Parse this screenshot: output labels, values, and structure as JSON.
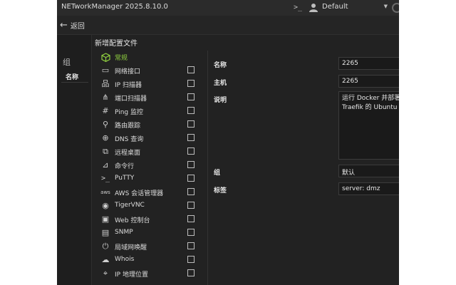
{
  "titlebar": {
    "app_title": "NETworkManager 2025.8.10.0",
    "profile": "Default"
  },
  "toolbar": {
    "back_label": "返回"
  },
  "left_panel": {
    "group_heading": "组",
    "name_header": "名称"
  },
  "dialog": {
    "title": "新增配置文件",
    "nav_items": [
      {
        "label": "常规",
        "icon": "cube-icon",
        "active": true
      },
      {
        "label": "网络接口",
        "icon": "network-interface-icon"
      },
      {
        "label": "IP 扫描器",
        "icon": "ip-scanner-icon"
      },
      {
        "label": "端口扫描器",
        "icon": "port-scanner-icon"
      },
      {
        "label": "Ping 监控",
        "icon": "ping-monitor-icon"
      },
      {
        "label": "路由跟踪",
        "icon": "traceroute-icon"
      },
      {
        "label": "DNS 查询",
        "icon": "dns-lookup-icon"
      },
      {
        "label": "远程桌面",
        "icon": "remote-desktop-icon"
      },
      {
        "label": "命令行",
        "icon": "powershell-icon"
      },
      {
        "label": "PuTTY",
        "icon": "putty-icon"
      },
      {
        "label": "AWS 会话管理器",
        "icon": "aws-icon"
      },
      {
        "label": "TigerVNC",
        "icon": "eye-icon"
      },
      {
        "label": "Web 控制台",
        "icon": "web-console-icon"
      },
      {
        "label": "SNMP",
        "icon": "snmp-icon"
      },
      {
        "label": "局域网唤醒",
        "icon": "power-icon"
      },
      {
        "label": "Whois",
        "icon": "cloud-icon"
      },
      {
        "label": "IP 地理位置",
        "icon": "map-icon"
      }
    ],
    "form": {
      "name_label": "名称",
      "name_value": "2265",
      "host_label": "主机",
      "host_value": "2265",
      "desc_label": "说明",
      "desc_value": "运行 Docker 并部署\nTraefik 的 Ubuntu Se",
      "group_label": "组",
      "group_value": "默认",
      "tags_label": "标签",
      "tags_value": "server: dmz"
    }
  },
  "colors": {
    "accent": "#8fcf3f",
    "background": "#1f1f1f"
  }
}
